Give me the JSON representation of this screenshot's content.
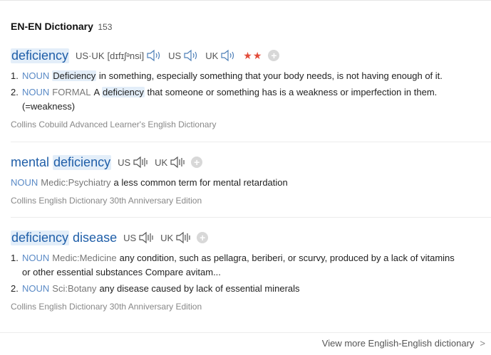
{
  "header": {
    "title": "EN-EN Dictionary",
    "count": "153"
  },
  "entries": [
    {
      "word": [
        "deficiency"
      ],
      "pron": {
        "label": "US·UK",
        "phonetic": "[dɪfɪʃᵊnsi]",
        "us": "US",
        "uk": "UK"
      },
      "stars": "★★",
      "defs": [
        {
          "num": "1.",
          "pos": "NOUN",
          "label": "",
          "pre": "",
          "hl": "Deficiency",
          "text": " in something, especially something that your body needs, is not having enough of it."
        },
        {
          "num": "2.",
          "pos": "NOUN",
          "label": "FORMAL",
          "pre": "A ",
          "hl": "deficiency",
          "text": " that someone or something has is a weakness or imperfection in them.",
          "cont": "(=weakness)"
        }
      ],
      "source": "Collins Cobuild Advanced Learner's English Dictionary"
    },
    {
      "word": [
        "mental",
        "deficiency"
      ],
      "pron": {
        "us": "US",
        "uk": "UK"
      },
      "defs": [
        {
          "pos": "NOUN",
          "label": "Medic:Psychiatry",
          "text": "a less common term for mental retardation"
        }
      ],
      "source": "Collins English Dictionary 30th Anniversary Edition"
    },
    {
      "word": [
        "deficiency",
        "disease"
      ],
      "pron": {
        "us": "US",
        "uk": "UK"
      },
      "defs": [
        {
          "num": "1.",
          "pos": "NOUN",
          "label": "Medic:Medicine",
          "text": "any condition, such as pellagra, beriberi, or scurvy, produced by a lack of vitamins",
          "cont": "or other essential substances Compare avitam..."
        },
        {
          "num": "2.",
          "pos": "NOUN",
          "label": "Sci:Botany",
          "text": "any disease caused by lack of essential minerals"
        }
      ],
      "source": "Collins English Dictionary 30th Anniversary Edition"
    }
  ],
  "footer": {
    "view_more": "View more English-English dictionary",
    "chevron": ">"
  },
  "icons": {
    "speaker": "speaker-icon",
    "add": "add-icon",
    "chevron": "chevron-right-icon"
  },
  "colors": {
    "word": "#1f5ea8",
    "highlight": "#e3eef9",
    "pos": "#5a8ac6",
    "stars": "#e34c3a"
  }
}
